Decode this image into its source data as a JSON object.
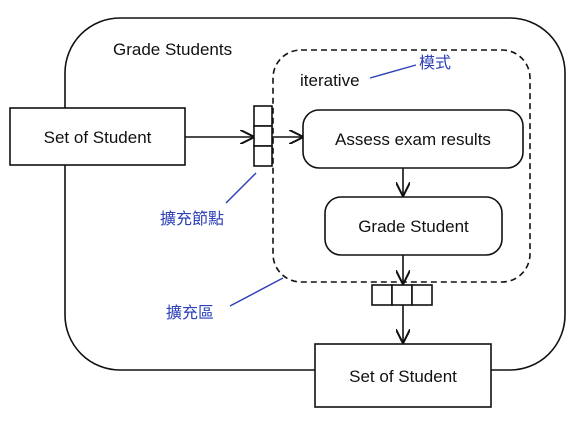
{
  "activity": {
    "title": "Grade Students",
    "input_pin_label": "Set of Student",
    "output_pin_label": "Set of Student"
  },
  "region": {
    "mode_keyword": "iterative",
    "actions": [
      {
        "label": "Assess exam results"
      },
      {
        "label": "Grade Student"
      }
    ]
  },
  "annotations": {
    "mode": "模式",
    "expansion_node": "擴充節點",
    "expansion_region": "擴充區"
  },
  "colors": {
    "line": "#111111",
    "annotation": "#2a3fb8",
    "background": "#ffffff"
  }
}
